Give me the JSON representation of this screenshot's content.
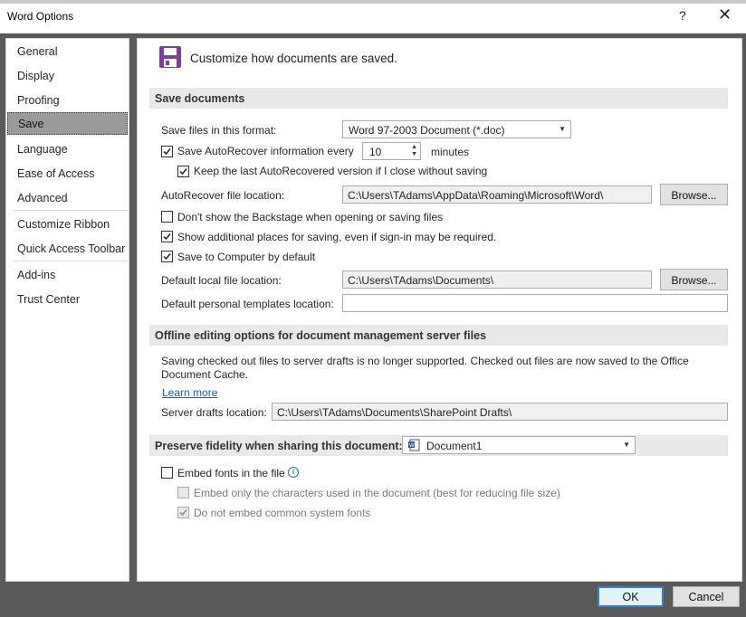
{
  "window": {
    "title": "Word Options",
    "help": "?",
    "close": "✕"
  },
  "sidebar": {
    "items": [
      {
        "label": "General"
      },
      {
        "label": "Display"
      },
      {
        "label": "Proofing"
      },
      {
        "label": "Save",
        "selected": true
      },
      {
        "label": "Language"
      },
      {
        "label": "Ease of Access"
      },
      {
        "label": "Advanced"
      },
      {
        "label": "Customize Ribbon"
      },
      {
        "label": "Quick Access Toolbar"
      },
      {
        "label": "Add-ins"
      },
      {
        "label": "Trust Center"
      }
    ]
  },
  "header": {
    "text": "Customize how documents are saved.",
    "icon": "save-icon",
    "icon_color": "#7b3f99"
  },
  "save_documents": {
    "section_title": "Save documents",
    "format_label": "Save files in this format:",
    "format_value": "Word 97-2003 Document (*.doc)",
    "autorecover_label": "Save AutoRecover information every",
    "autorecover_checked": true,
    "autorecover_minutes": "10",
    "minutes_label": "minutes",
    "keep_last_label": "Keep the last AutoRecovered version if I close without saving",
    "keep_last_checked": true,
    "autorecover_location_label": "AutoRecover file location:",
    "autorecover_location_value": "C:\\Users\\TAdams\\AppData\\Roaming\\Microsoft\\Word\\",
    "browse_label": "Browse...",
    "backstage_label": "Don't show the Backstage when opening or saving files",
    "backstage_checked": false,
    "additional_places_label": "Show additional places for saving, even if sign-in may be required.",
    "additional_places_checked": true,
    "save_computer_label": "Save to Computer by default",
    "save_computer_checked": true,
    "default_local_label": "Default local file location:",
    "default_local_value": "C:\\Users\\TAdams\\Documents\\",
    "browse2_label": "Browse...",
    "templates_label": "Default personal templates location:",
    "templates_value": ""
  },
  "offline": {
    "section_title": "Offline editing options for document management server files",
    "description": "Saving checked out files to server drafts is no longer supported. Checked out files are now saved to the Office Document Cache.",
    "learn_more": "Learn more",
    "server_drafts_label": "Server drafts location:",
    "server_drafts_value": "C:\\Users\\TAdams\\Documents\\SharePoint Drafts\\"
  },
  "fidelity": {
    "section_title": "Preserve fidelity when sharing this document:",
    "document_value": "Document1",
    "embed_fonts_label": "Embed fonts in the file",
    "embed_fonts_checked": false,
    "embed_chars_label": "Embed only the characters used in the document (best for reducing file size)",
    "embed_chars_checked": false,
    "no_system_fonts_label": "Do not embed common system fonts",
    "no_system_fonts_checked": true
  },
  "footer": {
    "ok_label": "OK",
    "cancel_label": "Cancel"
  },
  "colors": {
    "accent": "#3c7fc4",
    "selected_nav": "#9a9a9a",
    "section_bg": "#e9e9e9",
    "link": "#1a5fa8"
  }
}
